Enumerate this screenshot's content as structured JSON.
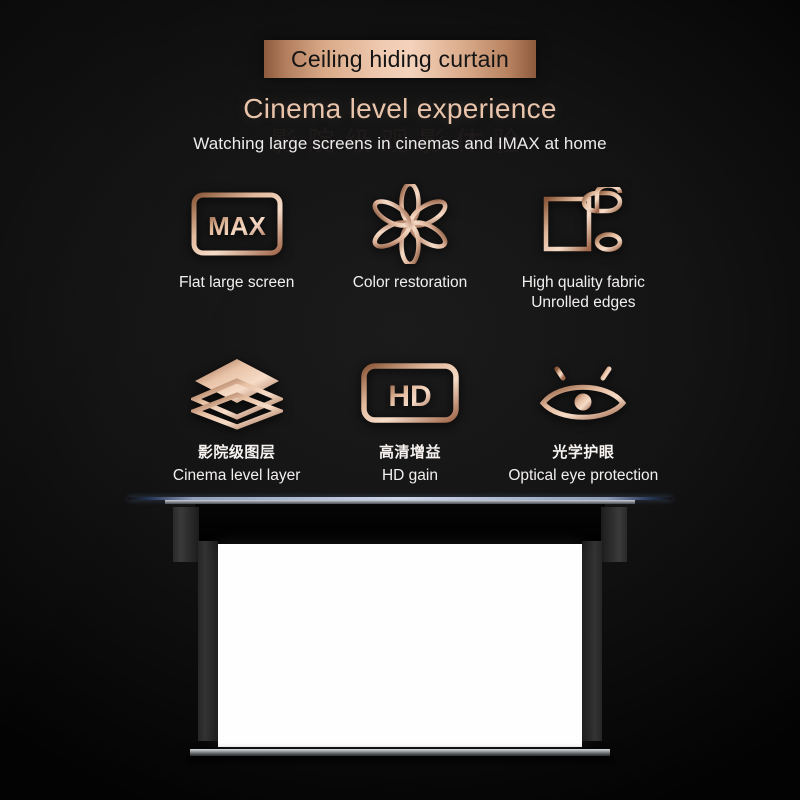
{
  "header": {
    "badge_label": "Ceiling hiding curtain",
    "headline": "Cinema level experience",
    "subline": "Watching large screens in cinemas and IMAX at home",
    "watermark": "影院级观影体验",
    "badge_gradient_start": "#8d5a3e",
    "badge_gradient_mid": "#f4d2bb",
    "headline_color": "#e9c4ab",
    "accent_color": "#d9a987"
  },
  "features": {
    "row1": [
      {
        "icon": "max-screen-icon",
        "icon_text": "MAX",
        "label": "Flat large screen"
      },
      {
        "icon": "flower-petal-icon",
        "icon_text": "",
        "label": "Color restoration"
      },
      {
        "icon": "fabric-roll-icon",
        "icon_text": "",
        "label": "High quality fabric\nUnrolled edges"
      }
    ],
    "row2": [
      {
        "icon": "layers-icon",
        "icon_text": "",
        "cn": "影院级图层",
        "en": "Cinema level layer"
      },
      {
        "icon": "hd-badge-icon",
        "icon_text": "HD",
        "cn": "高清增益",
        "en": "HD gain"
      },
      {
        "icon": "eye-protection-icon",
        "icon_text": "",
        "cn": "光学护眼",
        "en": "Optical eye protection"
      }
    ]
  },
  "product_image": {
    "name": "motorized-projector-screen",
    "surface_color": "#fefefe",
    "casing_color": "#050505",
    "rail_color": "#cdd7eb",
    "weight_bar_color": "#9a9da1"
  }
}
